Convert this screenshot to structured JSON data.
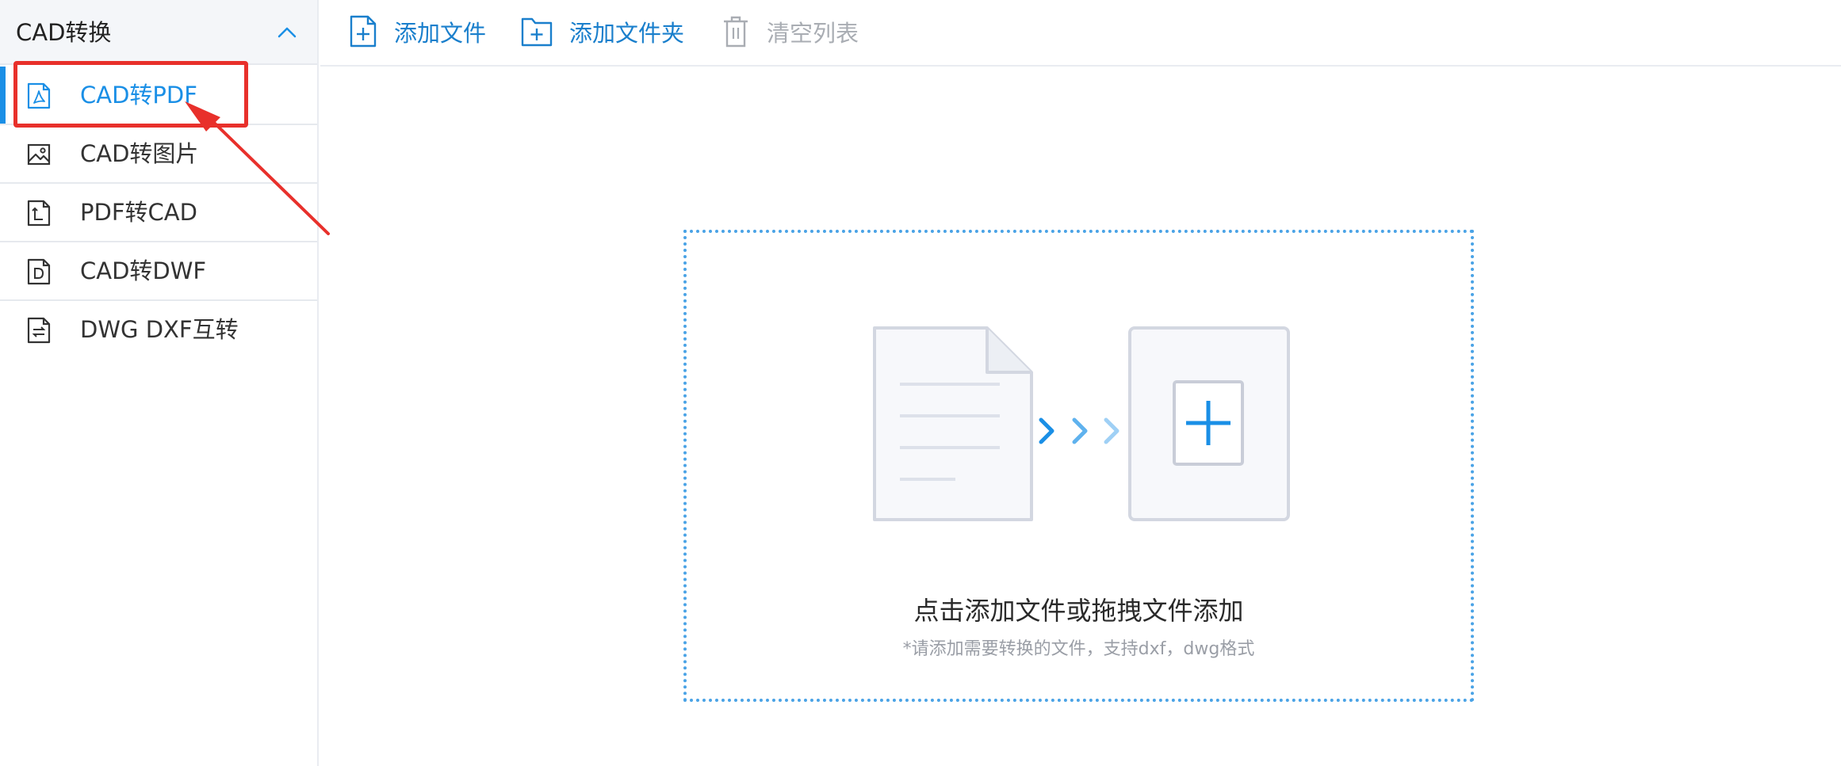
{
  "sidebar": {
    "title": "CAD转换",
    "collapse_icon": "chevron-up-icon",
    "items": [
      {
        "label": "CAD转PDF",
        "icon": "pdf-file-icon",
        "active": true
      },
      {
        "label": "CAD转图片",
        "icon": "image-icon",
        "active": false
      },
      {
        "label": "PDF转CAD",
        "icon": "pdf-to-cad-file-icon",
        "active": false
      },
      {
        "label": "CAD转DWF",
        "icon": "dwf-file-icon",
        "active": false
      },
      {
        "label": "DWG DXF互转",
        "icon": "swap-file-icon",
        "active": false
      }
    ]
  },
  "toolbar": {
    "add_file_label": "添加文件",
    "add_folder_label": "添加文件夹",
    "clear_list_label": "清空列表"
  },
  "dropzone": {
    "main_text": "点击添加文件或拖拽文件添加",
    "sub_text": "*请添加需要转换的文件，支持dxf，dwg格式"
  },
  "colors": {
    "accent": "#1a8fe6",
    "annotation": "#e8302b",
    "dropzone_border": "#4aa3e6",
    "disabled_text": "#a9adb3"
  }
}
